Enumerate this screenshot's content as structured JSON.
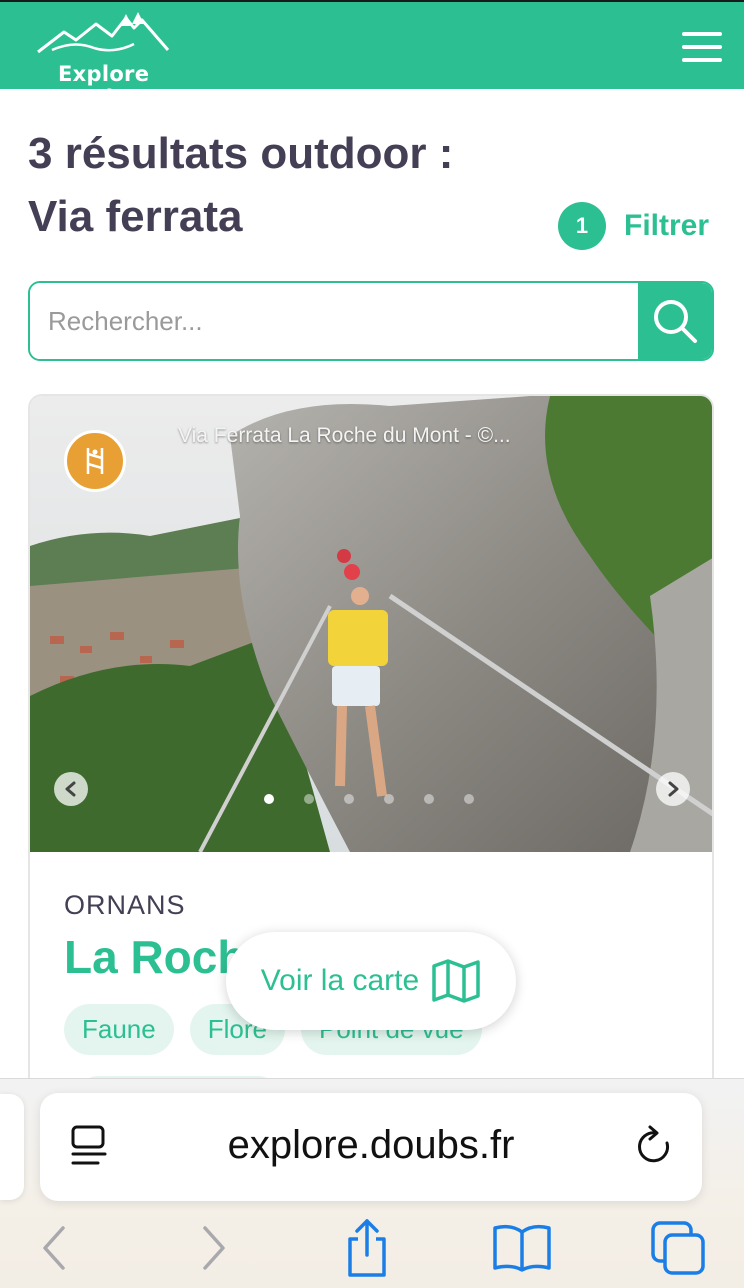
{
  "header": {
    "logo_text": "Explore Doubs",
    "brand_color": "#2cbf92"
  },
  "results": {
    "title_line1": "3 résultats outdoor :",
    "title_line2": "Via ferrata",
    "filter_count": "1",
    "filter_label": "Filtrer"
  },
  "search": {
    "placeholder": "Rechercher..."
  },
  "card": {
    "photo_caption": "Via Ferrata La Roche du Mont - ©...",
    "category_icon": "climbing-icon",
    "category_color": "#e8a034",
    "carousel_total": 6,
    "carousel_active": 1,
    "city": "ORNANS",
    "title": "La Roch",
    "tags": [
      "Faune",
      "Flore",
      "Point de vue"
    ]
  },
  "map_button": {
    "label": "Voir la carte",
    "icon": "map-icon"
  },
  "browser": {
    "url": "explore.doubs.fr",
    "accent_color": "#1a7ee6"
  }
}
